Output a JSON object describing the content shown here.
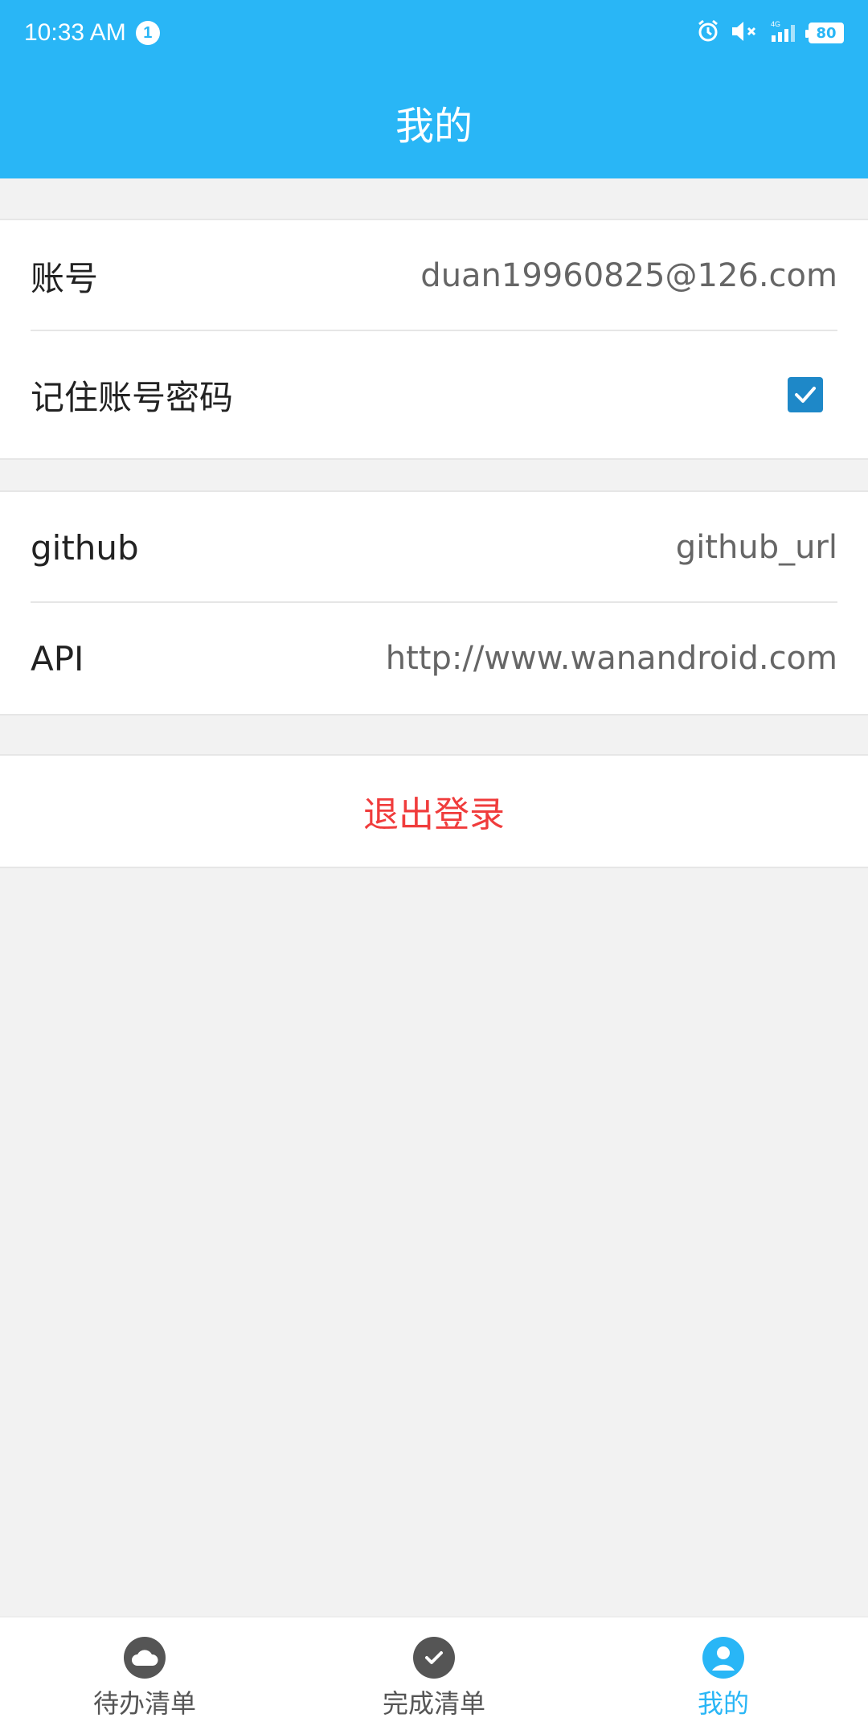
{
  "status_bar": {
    "time": "10:33 AM",
    "notification_count": "1",
    "battery": "80",
    "network": "4G"
  },
  "app_bar": {
    "title": "我的"
  },
  "account_group": {
    "account_label": "账号",
    "account_value": "duan19960825@126.com",
    "remember_label": "记住账号密码",
    "remember_checked": true
  },
  "links_group": {
    "github_label": "github",
    "github_value": "github_url",
    "api_label": "API",
    "api_value": "http://www.wanandroid.com"
  },
  "logout": {
    "label": "退出登录"
  },
  "bottom_nav": {
    "items": [
      {
        "label": "待办清单",
        "icon": "cloud-icon",
        "active": false
      },
      {
        "label": "完成清单",
        "icon": "check-circle-icon",
        "active": false
      },
      {
        "label": "我的",
        "icon": "person-icon",
        "active": true
      }
    ]
  },
  "colors": {
    "primary": "#29b6f6",
    "logout": "#f03c3c",
    "checkbox": "#1e88c8"
  }
}
